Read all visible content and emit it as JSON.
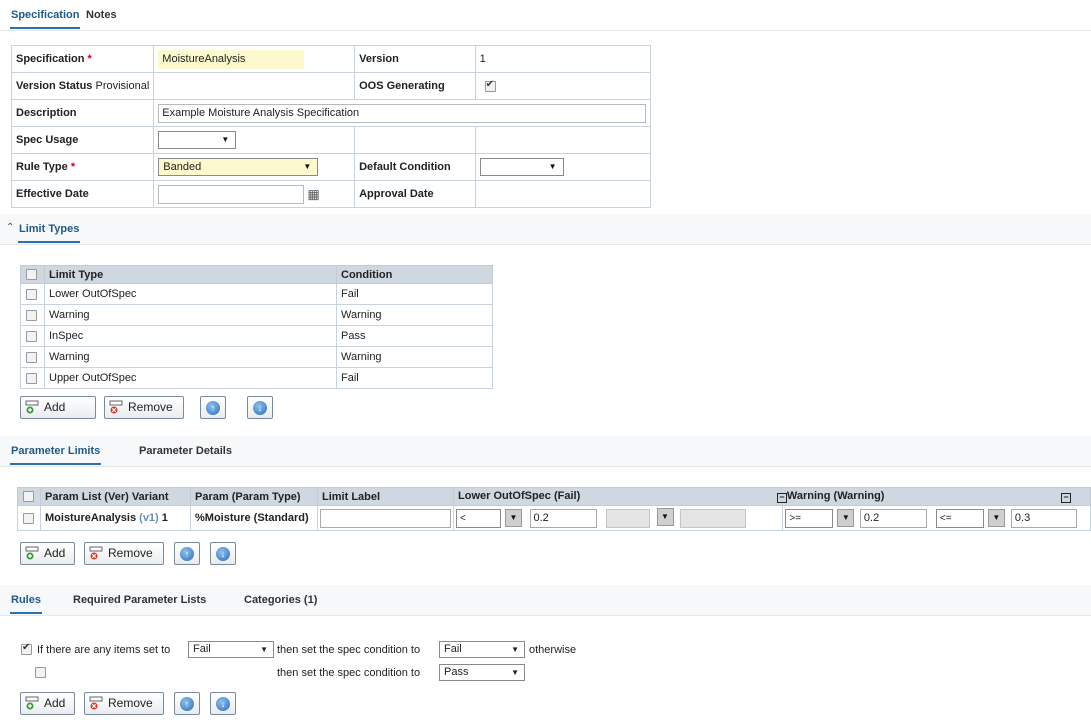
{
  "top_tabs": {
    "specification": "Specification",
    "notes": "Notes"
  },
  "spec": {
    "specification_label": "Specification",
    "specification_value": "MoistureAnalysis",
    "version_label": "Version",
    "version_value": "1",
    "version_status_label": "Version Status",
    "version_status_value": "Provisional",
    "oos_generating_label": "OOS Generating",
    "oos_generating_checked": true,
    "description_label": "Description",
    "description_value": "Example Moisture Analysis Specification",
    "spec_usage_label": "Spec Usage",
    "spec_usage_value": "",
    "rule_type_label": "Rule Type",
    "rule_type_value": "Banded",
    "default_condition_label": "Default Condition",
    "default_condition_value": "",
    "effective_date_label": "Effective Date",
    "effective_date_value": "",
    "approval_date_label": "Approval Date",
    "required_marker": "*"
  },
  "limit_types": {
    "section_title": "Limit Types",
    "headers": {
      "limit_type": "Limit Type",
      "condition": "Condition"
    },
    "rows": [
      {
        "limit_type": "Lower OutOfSpec",
        "condition": "Fail"
      },
      {
        "limit_type": "Warning",
        "condition": "Warning"
      },
      {
        "limit_type": "InSpec",
        "condition": "Pass"
      },
      {
        "limit_type": "Warning",
        "condition": "Warning"
      },
      {
        "limit_type": "Upper OutOfSpec",
        "condition": "Fail"
      }
    ]
  },
  "buttons": {
    "add": "Add",
    "remove": "Remove"
  },
  "param_tabs": {
    "parameter_limits": "Parameter Limits",
    "parameter_details": "Parameter Details"
  },
  "param_limits": {
    "headers": {
      "param_list": "Param List (Ver) Variant",
      "param": "Param (Param Type)",
      "limit_label": "Limit Label",
      "lower_oos": "Lower OutOfSpec (Fail)",
      "warning": "Warning (Warning)"
    },
    "row": {
      "param_list_name": "MoistureAnalysis",
      "param_list_version": "(v1)",
      "variant": "1",
      "param": "%Moisture (Standard)",
      "limit_label": "",
      "lower_op": "<",
      "lower_value": "0.2",
      "warn_op1": ">=",
      "warn_value1": "0.2",
      "warn_op2": "<=",
      "warn_value2": "0.3"
    }
  },
  "rules_tabs": {
    "rules": "Rules",
    "required": "Required Parameter Lists",
    "categories": "Categories (1)"
  },
  "rules": {
    "row1_prefix": "If there are any items set to",
    "row1_items_value": "Fail",
    "then_text": "then set the spec condition to",
    "row1_condition_value": "Fail",
    "otherwise_text": "otherwise",
    "row2_condition_value": "Pass"
  }
}
